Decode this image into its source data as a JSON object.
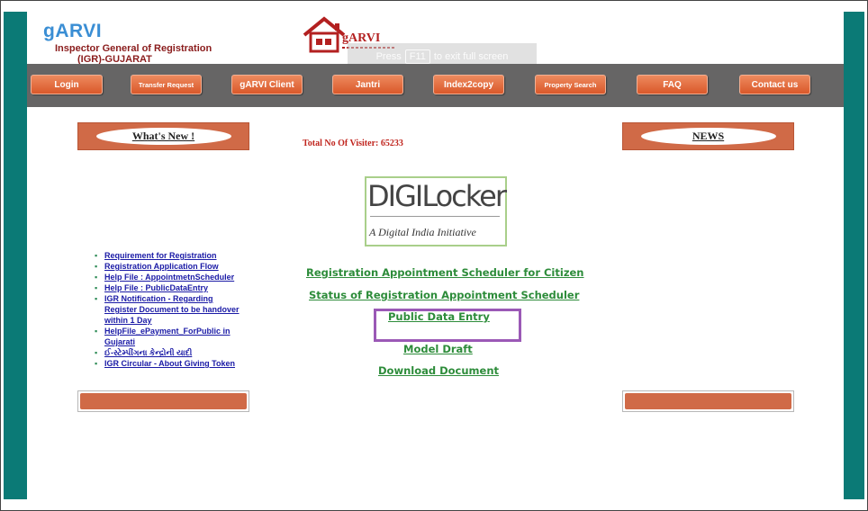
{
  "brand": {
    "title": "gARVI",
    "subtitle_line1": "Inspector General of Registration",
    "subtitle_line2": "(IGR)-GUJARAT",
    "logo_text": "gARVI"
  },
  "fullscreen_toast": {
    "prefix": "Press",
    "key": "F11",
    "suffix": "to exit full screen"
  },
  "nav": [
    {
      "label": "Login"
    },
    {
      "label": "Transfer Request"
    },
    {
      "label": "gARVI Client"
    },
    {
      "label": "Jantri"
    },
    {
      "label": "Index2copy"
    },
    {
      "label": "Property Search"
    },
    {
      "label": "FAQ"
    },
    {
      "label": "Contact us"
    }
  ],
  "panels": {
    "whats_new": "What's New !",
    "news": "NEWS"
  },
  "visitor_count": "Total No Of Visiter: 65233",
  "digilocker": {
    "title": "DIGILocker",
    "tagline": "A Digital India Initiative"
  },
  "whats_new_items": [
    "Requirement for Registration",
    "Registration Application Flow",
    "Help File : AppointmetnScheduler",
    "Help File : PublicDataEntry",
    "IGR Notification - Regarding Register Document to be handover within 1 Day",
    "HelpFile_ePayment_ForPublic in Gujarati",
    "ઈ-સ્ટેમ્પીંગના કેન્દ્રોની યાદી",
    "IGR Circular - About Giving Token"
  ],
  "center_links": [
    "Registration Appointment Scheduler for Citizen",
    "Status of Registration Appointment Scheduler",
    "Public Data Entry",
    "Model Draft",
    "Download Document"
  ],
  "colors": {
    "accent_teal": "#0b7a76",
    "nav_bar": "#666565",
    "button_orange": "#d9582a",
    "link_green": "#2d8c3a",
    "link_blue": "#1a1aa6",
    "highlight_purple": "#9b59b6"
  }
}
